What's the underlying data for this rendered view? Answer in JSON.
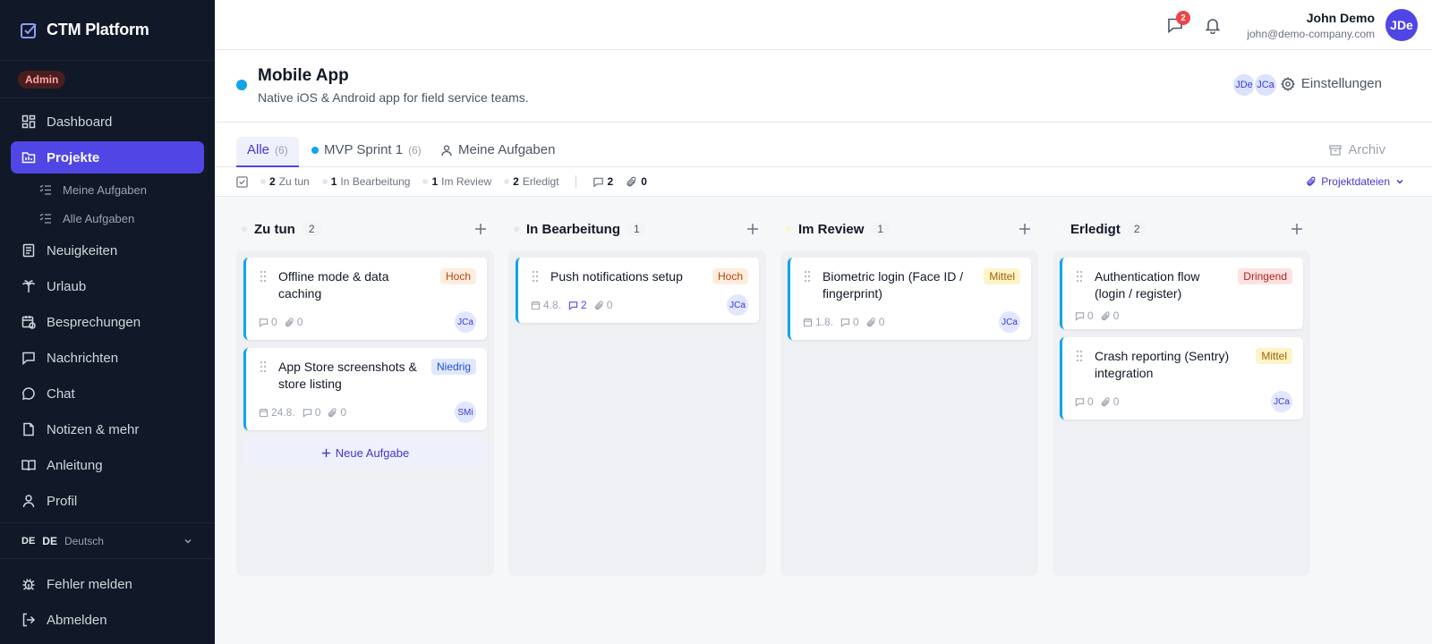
{
  "brand": {
    "name": "CTM Platform"
  },
  "role_badge": "Admin",
  "nav": {
    "dashboard": "Dashboard",
    "projekte": "Projekte",
    "meine_aufgaben": "Meine Aufgaben",
    "alle_aufgaben": "Alle Aufgaben",
    "neuigkeiten": "Neuigkeiten",
    "urlaub": "Urlaub",
    "besprechungen": "Besprechungen",
    "nachrichten": "Nachrichten",
    "chat": "Chat",
    "notizen": "Notizen & mehr",
    "anleitung": "Anleitung",
    "profil": "Profil"
  },
  "language": {
    "flag_code": "DE",
    "code": "DE",
    "name": "Deutsch"
  },
  "bottom_nav": {
    "bug": "Fehler melden",
    "logout": "Abmelden"
  },
  "topbar": {
    "message_badge": "2",
    "user_name": "John Demo",
    "user_email": "john@demo-company.com",
    "user_initials": "JDe"
  },
  "project": {
    "title": "Mobile App",
    "description": "Native iOS & Android app for field service teams.",
    "members": [
      "JDe",
      "JCa"
    ],
    "settings_label": "Einstellungen",
    "accent": "#0ea5e9"
  },
  "tabs": [
    {
      "label": "Alle",
      "count": "(6)"
    },
    {
      "label": "MVP Sprint 1",
      "count": "(6)"
    },
    {
      "label": "Meine Aufgaben",
      "count": ""
    }
  ],
  "archive_label": "Archiv",
  "stats": {
    "todo_count": "2",
    "todo_label": "Zu tun",
    "progress_count": "1",
    "progress_label": "In Bearbeitung",
    "review_count": "1",
    "review_label": "Im Review",
    "done_count": "2",
    "done_label": "Erledigt",
    "comments": "2",
    "attachments": "0",
    "files_label": "Projektdateien"
  },
  "columns": [
    {
      "title": "Zu tun",
      "count": "2",
      "cards": [
        {
          "title": "Offline mode & data caching",
          "priority": "Hoch",
          "date": "",
          "comments": "0",
          "attachments": "0",
          "assignee": "JCa"
        },
        {
          "title": "App Store screenshots & store listing",
          "priority": "Niedrig",
          "date": "24.8.",
          "comments": "0",
          "attachments": "0",
          "assignee": "SMi"
        }
      ],
      "new_task_label": "Neue Aufgabe"
    },
    {
      "title": "In Bearbeitung",
      "count": "1",
      "cards": [
        {
          "title": "Push notifications setup",
          "priority": "Hoch",
          "date": "4.8.",
          "comments": "2",
          "attachments": "0",
          "assignee": "JCa"
        }
      ]
    },
    {
      "title": "Im Review",
      "count": "1",
      "cards": [
        {
          "title": "Biometric login (Face ID / fingerprint)",
          "priority": "Mittel",
          "date": "1.8.",
          "comments": "0",
          "attachments": "0",
          "assignee": "JCa"
        }
      ]
    },
    {
      "title": "Erledigt",
      "count": "2",
      "cards": [
        {
          "title": "Authentication flow (login / register)",
          "priority": "Dringend",
          "date": "",
          "comments": "0",
          "attachments": "0",
          "assignee": ""
        },
        {
          "title": "Crash reporting (Sentry) integration",
          "priority": "Mittel",
          "date": "",
          "comments": "0",
          "attachments": "0",
          "assignee": "JCa"
        }
      ]
    }
  ],
  "colors": {
    "sidebar_bg": "#111827",
    "accent": "#4f46e5",
    "card_border": "#0ea5e9"
  }
}
